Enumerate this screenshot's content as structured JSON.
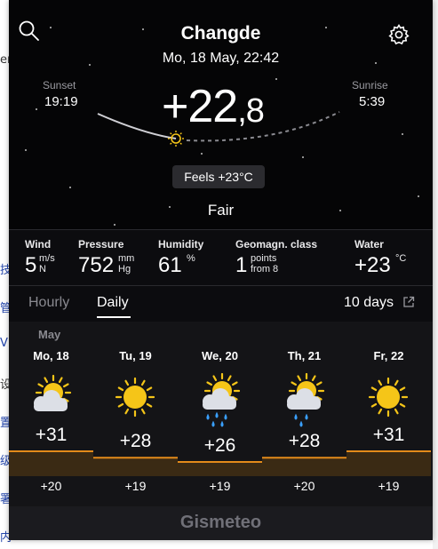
{
  "background_page": {
    "left_chars": [
      "er",
      "技",
      "管",
      "V",
      "设",
      "置",
      "级",
      "署",
      "内"
    ]
  },
  "header": {
    "city": "Changde",
    "datetime": "Mo, 18 May, 22:42",
    "sunset_label": "Sunset",
    "sunset_time": "19:19",
    "sunrise_label": "Sunrise",
    "sunrise_time": "5:39",
    "temp_int": "+22",
    "temp_dec": ",8",
    "feels_like": "Feels +23°C",
    "condition": "Fair",
    "search_icon": "search-icon",
    "settings_icon": "gear-icon"
  },
  "details": {
    "wind": {
      "label": "Wind",
      "value": "5",
      "unit_top": "m/s",
      "unit_bottom": "N"
    },
    "pressure": {
      "label": "Pressure",
      "value": "752",
      "unit_top": "mm",
      "unit_bottom": "Hg"
    },
    "humidity": {
      "label": "Humidity",
      "value": "61",
      "unit_top": "%"
    },
    "geomagnetic": {
      "label": "Geomagn. class",
      "value": "1",
      "unit_top": "points",
      "unit_bottom": "from 8"
    },
    "water": {
      "label": "Water",
      "value": "+23",
      "unit_top": "°C"
    }
  },
  "tabs": {
    "hourly": "Hourly",
    "daily": "Daily",
    "active": "Daily",
    "ten_days": "10 days",
    "ten_days_icon": "external-link-icon"
  },
  "forecast": {
    "month": "May",
    "days": [
      {
        "name": "Mo, 18",
        "icon": "partly-cloudy-icon",
        "max": "+31",
        "min": "+20",
        "max_value": 31
      },
      {
        "name": "Tu, 19",
        "icon": "sunny-icon",
        "max": "+28",
        "min": "+19",
        "max_value": 28
      },
      {
        "name": "We, 20",
        "icon": "partly-cloudy-rain-icon",
        "max": "+26",
        "min": "+19",
        "max_value": 26
      },
      {
        "name": "Th, 21",
        "icon": "partly-cloudy-light-rain-icon",
        "max": "+28",
        "min": "+20",
        "max_value": 28
      },
      {
        "name": "Fr, 22",
        "icon": "sunny-icon",
        "max": "+31",
        "min": "+19",
        "max_value": 31
      }
    ]
  },
  "footer": {
    "brand": "Gismeteo"
  },
  "colors": {
    "background": "#0c0c0f",
    "sun": "#f5c518",
    "temp_band": "#e38a1a",
    "rain": "#3aa0ff"
  }
}
